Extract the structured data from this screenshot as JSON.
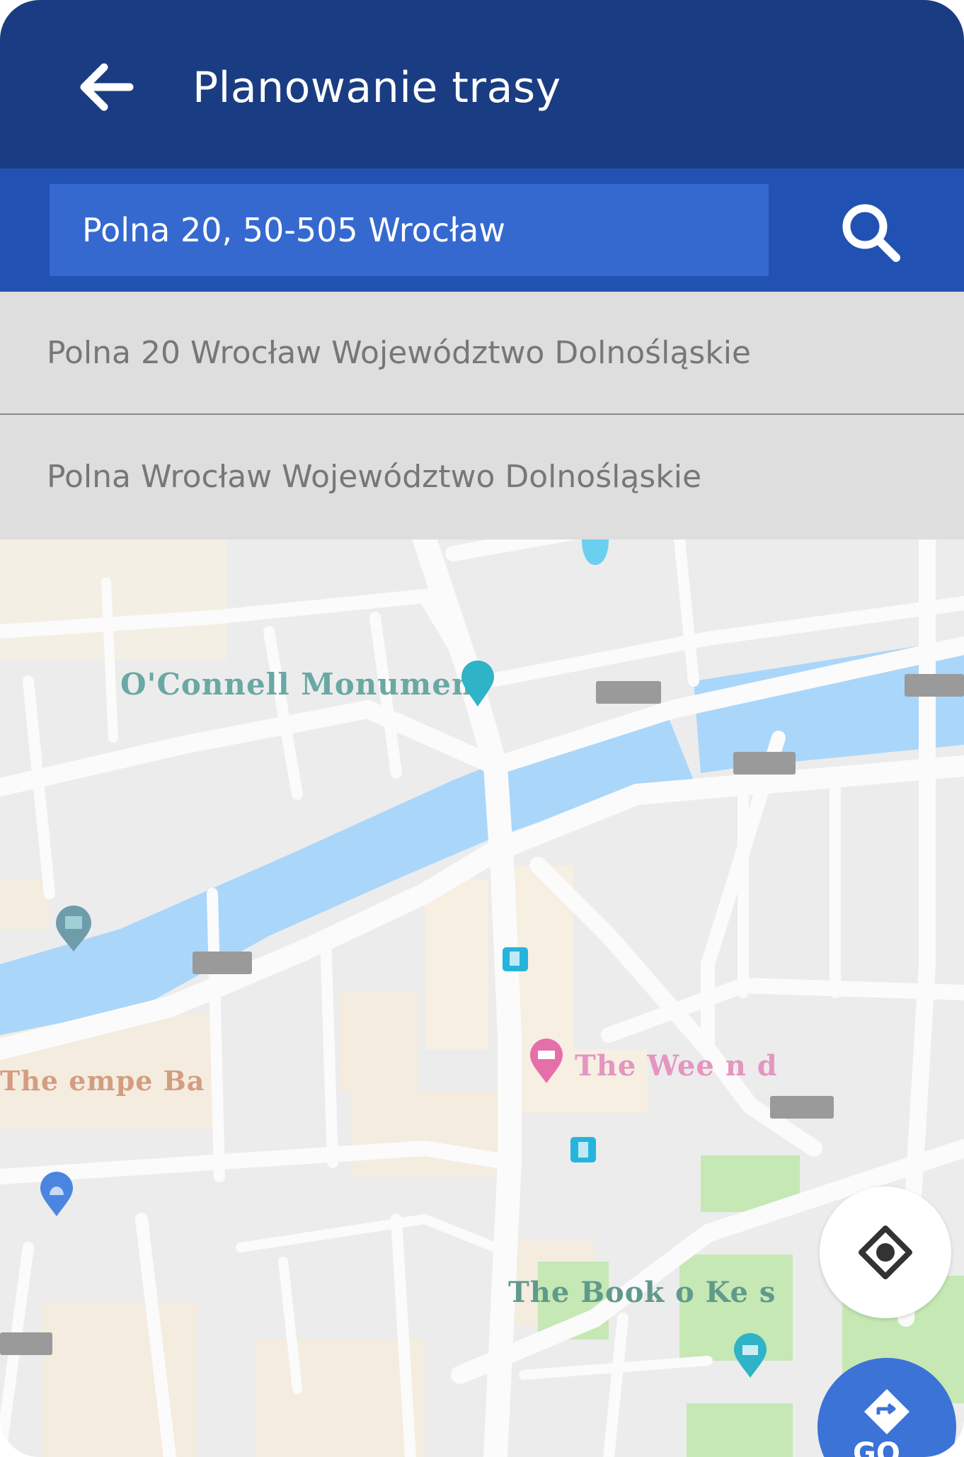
{
  "appbar": {
    "title": "Planowanie trasy",
    "back_icon": "arrow-left-icon",
    "background": "#1a3c82"
  },
  "search": {
    "value": "Polna 20, 50-505 Wrocław",
    "icon": "search-icon",
    "background": "#2152b3"
  },
  "suggestions": [
    {
      "label": "Polna 20 Wrocław Województwo Dolnośląskie"
    },
    {
      "label": "Polna Wrocław Województwo Dolnośląskie"
    }
  ],
  "map": {
    "labels": {
      "monument": "O'Connell Monumen",
      "weekend": "The Wee  n  d",
      "temple_bar": "The  empe Ba",
      "book_of_kells": "The Book o  Ke  s"
    },
    "colors": {
      "water": "#aad6fa",
      "park": "#c5e8b4",
      "road": "#fbfbfb",
      "land": "#ececec"
    }
  },
  "fab": {
    "locate_icon": "my-location-icon",
    "go_icon": "directions-icon",
    "go_label": "GO"
  }
}
